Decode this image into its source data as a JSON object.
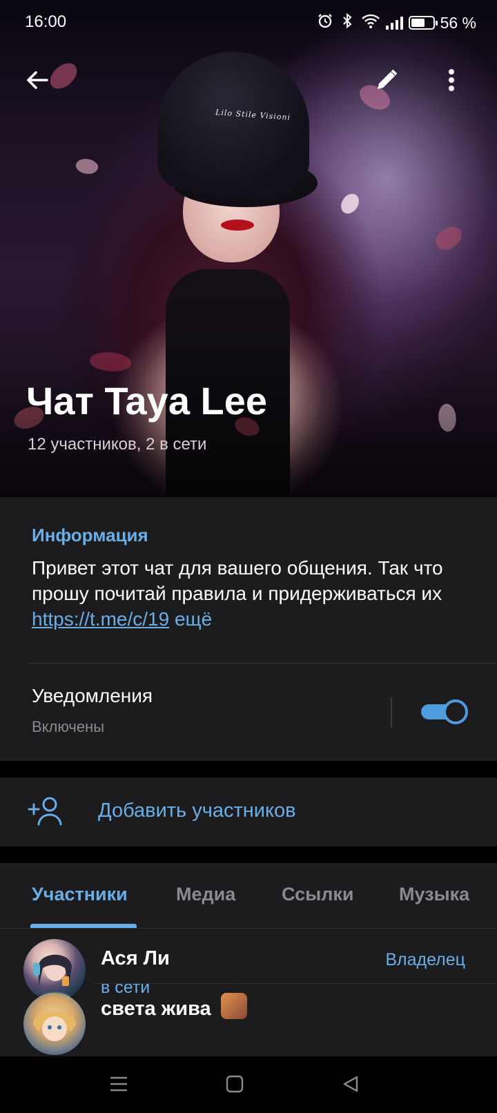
{
  "status_bar": {
    "time": "16:00",
    "battery_text": "56 %",
    "battery_level_percent": 56,
    "icons": [
      "alarm-icon",
      "bluetooth-icon",
      "wifi-icon",
      "signal-icon",
      "battery-icon"
    ]
  },
  "top_bar": {
    "back_icon": "arrow-left-icon",
    "edit_icon": "pencil-icon",
    "menu_icon": "more-vertical-icon"
  },
  "hero": {
    "cap_text": "Lilo Stile Visioni",
    "title": "Чат Taya Lee",
    "subtitle": "12 участников, 2 в сети"
  },
  "info": {
    "heading": "Информация",
    "description": "Привет этот чат для вашего общения. Так что прошу почитай правила и придерживаться их ",
    "link_text": "https://t.me/c/19",
    "more_label": " ещё"
  },
  "notifications": {
    "label": "Уведомления",
    "status": "Включены",
    "enabled": true
  },
  "add_members": {
    "label": "Добавить участников",
    "icon": "add-user-icon"
  },
  "tabs": [
    {
      "label": "Участники",
      "active": true
    },
    {
      "label": "Медиа",
      "active": false
    },
    {
      "label": "Ссылки",
      "active": false
    },
    {
      "label": "Музыка",
      "active": false
    }
  ],
  "members": [
    {
      "name": "Ася Ли",
      "status": "в сети",
      "role": "Владелец"
    },
    {
      "name": "света жива",
      "status": "",
      "role": ""
    }
  ],
  "nav_bar": {
    "icons": [
      "menu-icon",
      "home-square-icon",
      "back-triangle-icon"
    ]
  },
  "colors": {
    "accent": "#6aaee8",
    "panel": "#1c1c1e",
    "background": "#000000"
  }
}
